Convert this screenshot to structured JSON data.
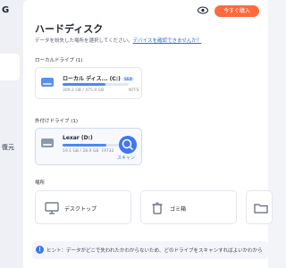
{
  "sidebar": {
    "logo_fragment": "G",
    "item_fragment": "復元"
  },
  "topbar": {
    "buy_label": "今すぐ購入"
  },
  "page": {
    "title": "ハードディスク",
    "subtitle": "データを紛失した場所を選択してください。",
    "subtitle_link": "デバイスを確認できませんか？"
  },
  "local": {
    "header": "ローカルドライブ (1)",
    "drives": [
      {
        "name": "ローカル ディス... (C:)",
        "badge": "SSD",
        "size": "309.2 GB / 475.9 GB",
        "fs": "NTFS",
        "used_fraction": 0.65
      }
    ]
  },
  "external": {
    "header": "外付けドライブ (1)",
    "drives": [
      {
        "name": "Lexar (D:)",
        "size": "19.1 GB / 28.9 GB",
        "fs": "FAT32",
        "used_fraction": 0.66,
        "scan_label": "スキャン"
      }
    ]
  },
  "locations": {
    "header": "場所",
    "items": [
      {
        "label": "デスクトップ",
        "icon": "monitor-icon"
      },
      {
        "label": "ゴミ箱",
        "icon": "trash-icon"
      },
      {
        "label": "",
        "icon": "folder-icon"
      }
    ]
  },
  "hint": {
    "text": "ヒント：データがどこで失われたかわからないため、どのドライブをスキャンすればよいかわから"
  },
  "colors": {
    "accent": "#3e77f0",
    "buy": "#ff6a3d"
  }
}
